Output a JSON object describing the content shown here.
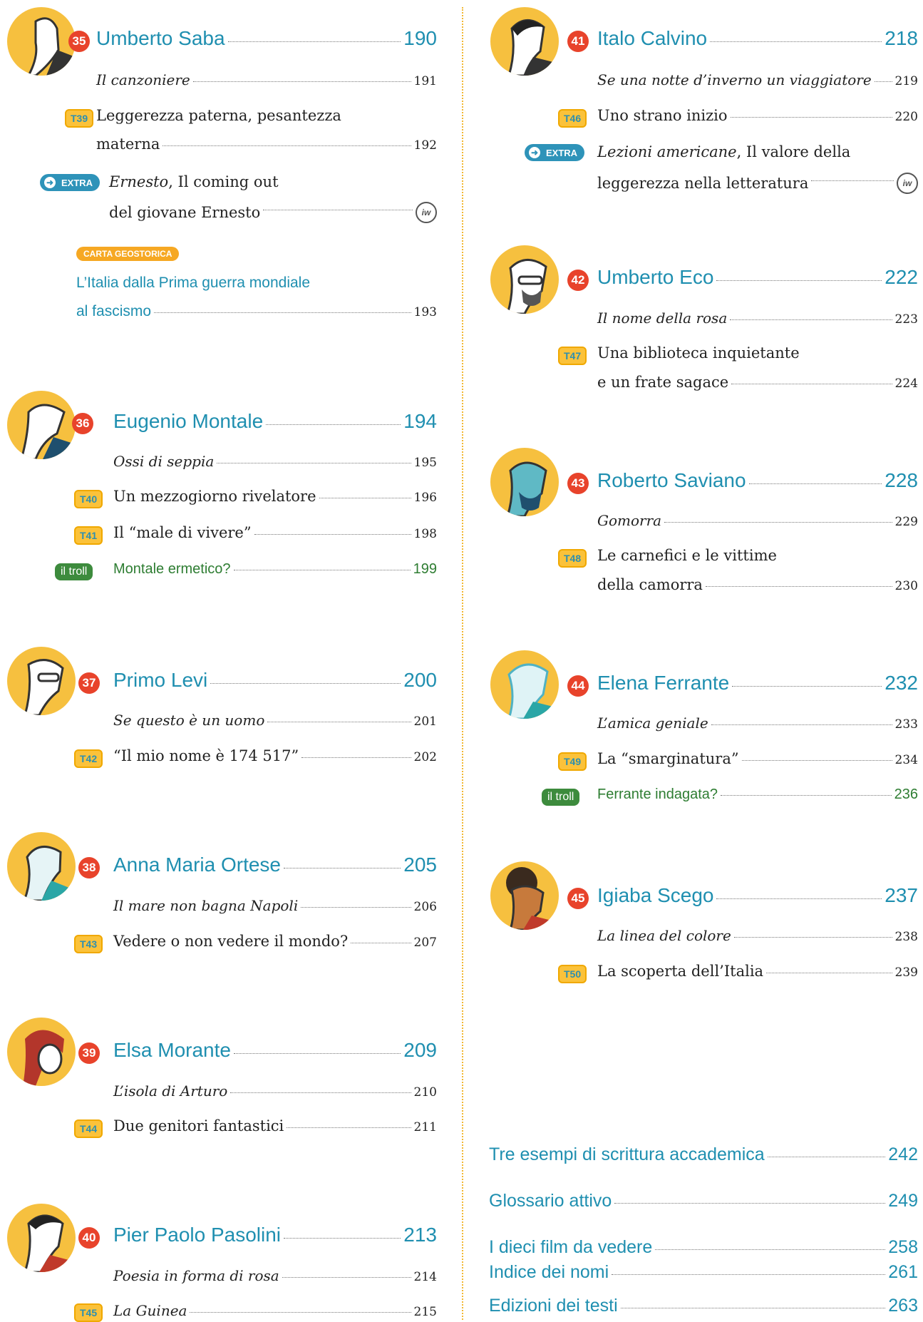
{
  "left": {
    "saba": {
      "num": "35",
      "name": "Umberto Saba",
      "page": "190",
      "work": "Il canzoniere",
      "work_page": "191",
      "t": "T39",
      "t_line1": "Leggerezza paterna, pesantezza",
      "t_line2": "materna",
      "t_page": "192",
      "extra_label": "EXTRA",
      "extra_title": "Ernesto",
      "extra_line1_rest": ", Il coming out",
      "extra_line2": "del giovane Ernesto",
      "iw": "iw"
    },
    "carta": {
      "badge": "CARTA GEOSTORICA",
      "line1": "L’Italia dalla Prima guerra mondiale",
      "line2": "al fascismo",
      "page": "193"
    },
    "montale": {
      "num": "36",
      "name": "Eugenio Montale",
      "page": "194",
      "work": "Ossi di seppia",
      "work_page": "195",
      "t1": "T40",
      "t1_title": "Un mezzogiorno rivelatore",
      "t1_page": "196",
      "t2": "T41",
      "t2_title": "Il “male di vivere”",
      "t2_page": "198",
      "troll_label": "il troll",
      "troll_title": "Montale ermetico?",
      "troll_page": "199"
    },
    "levi": {
      "num": "37",
      "name": "Primo Levi",
      "page": "200",
      "work": "Se questo è un uomo",
      "work_page": "201",
      "t": "T42",
      "t_title": "“Il mio nome è 174 517”",
      "t_page": "202"
    },
    "ortese": {
      "num": "38",
      "name": "Anna Maria Ortese",
      "page": "205",
      "work": "Il mare non bagna Napoli",
      "work_page": "206",
      "t": "T43",
      "t_title": "Vedere o non vedere il mondo?",
      "t_page": "207"
    },
    "morante": {
      "num": "39",
      "name": "Elsa Morante",
      "page": "209",
      "work": "L’isola di Arturo",
      "work_page": "210",
      "t": "T44",
      "t_title": "Due genitori fantastici",
      "t_page": "211"
    },
    "pasolini": {
      "num": "40",
      "name": "Pier Paolo Pasolini",
      "page": "213",
      "work": "Poesia in forma di rosa",
      "work_page": "214",
      "t": "T45",
      "t_title": "La Guinea",
      "t_page": "215"
    }
  },
  "right": {
    "calvino": {
      "num": "41",
      "name": "Italo Calvino",
      "page": "218",
      "work": "Se una notte d’inverno un viaggiatore",
      "work_page": "219",
      "t": "T46",
      "t_title": "Uno strano inizio",
      "t_page": "220",
      "extra_label": "EXTRA",
      "extra_title": "Lezioni americane",
      "extra_line1_rest": ", Il valore della",
      "extra_line2": "leggerezza nella letteratura",
      "iw": "iw"
    },
    "eco": {
      "num": "42",
      "name": "Umberto Eco",
      "page": "222",
      "work": "Il nome della rosa",
      "work_page": "223",
      "t": "T47",
      "t_line1": "Una biblioteca inquietante",
      "t_line2": "e un frate sagace",
      "t_page": "224"
    },
    "saviano": {
      "num": "43",
      "name": "Roberto Saviano",
      "page": "228",
      "work": "Gomorra",
      "work_page": "229",
      "t": "T48",
      "t_line1": "Le carnefici e le vittime",
      "t_line2": "della camorra",
      "t_page": "230"
    },
    "ferrante": {
      "num": "44",
      "name": "Elena Ferrante",
      "page": "232",
      "work": "L’amica geniale",
      "work_page": "233",
      "t": "T49",
      "t_title": "La “smarginatura”",
      "t_page": "234",
      "troll_label": "il troll",
      "troll_title": "Ferrante indagata?",
      "troll_page": "236"
    },
    "scego": {
      "num": "45",
      "name": "Igiaba Scego",
      "page": "237",
      "work": "La linea del colore",
      "work_page": "238",
      "t": "T50",
      "t_title": "La scoperta dell’Italia",
      "t_page": "239"
    },
    "back": [
      {
        "title": "Tre esempi di scrittura accademica",
        "page": "242"
      },
      {
        "title": "Glossario attivo",
        "page": "249"
      },
      {
        "title": "I dieci film da vedere",
        "page": "258"
      },
      {
        "title": "Indice dei nomi",
        "page": "261"
      },
      {
        "title": "Edizioni dei testi",
        "page": "263"
      }
    ]
  }
}
